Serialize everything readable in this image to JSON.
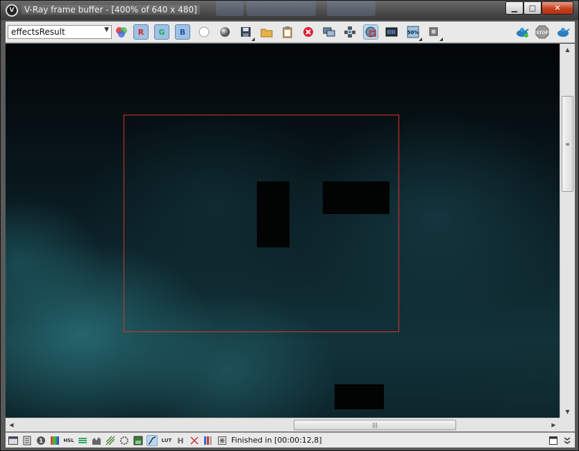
{
  "window": {
    "title": "V-Ray frame buffer - [400% of 640 x 480]",
    "app_icon": "vray-logo-icon",
    "controls": {
      "minimize": "▁",
      "maximize": "□",
      "close": "✕"
    }
  },
  "toolbar": {
    "channel_select": {
      "value": "effectsResult"
    },
    "channel_buttons": {
      "red": "R",
      "green": "G",
      "blue": "B"
    },
    "zoom_label": "50%",
    "icons": [
      "channels-color-icon",
      "red-channel-toggle",
      "green-channel-toggle",
      "blue-channel-toggle",
      "view-alpha-icon",
      "monochrome-icon",
      "save-image-icon",
      "load-image-icon",
      "copy-to-clipboard-icon",
      "clear-image-icon",
      "duplicate-to-history-icon",
      "track-mouse-icon",
      "region-render-icon",
      "link-to-settings-icon",
      "zoom-50-icon",
      "pixel-info-icon",
      "render-icon",
      "stop-render-icon",
      "interactive-render-icon"
    ],
    "stop_label": "STOP"
  },
  "viewport": {
    "description_colors": {
      "region_border": "#d8322b",
      "scene_tint": "#12333a"
    }
  },
  "statusbar": {
    "status_text": "Finished in [00:00:12,8]",
    "icons": [
      "display-window-icon",
      "history-icon",
      "info-icon",
      "color-correction-icon",
      "hsl-icon",
      "levels-icon",
      "curves-icon",
      "exposure-icon",
      "lens-effects-icon",
      "background-icon",
      "color-curve-icon",
      "lut-icon",
      "histogram-icon",
      "ocio-icon",
      "bars-icon",
      "stamp-icon"
    ],
    "labels": {
      "hsl": "HSL",
      "lut": "LUT",
      "h": "H"
    }
  }
}
